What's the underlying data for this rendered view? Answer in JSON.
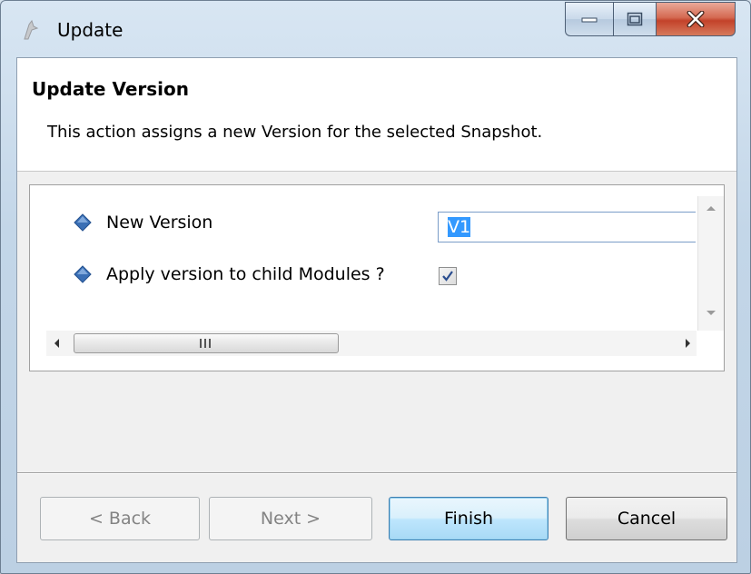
{
  "window": {
    "title": "Update",
    "icons": {
      "app": "app-icon",
      "minimize": "minimize-icon",
      "maximize": "maximize-icon",
      "close": "close-icon"
    }
  },
  "banner": {
    "title": "Update Version",
    "description": "This action assigns a new Version for the selected Snapshot."
  },
  "form": {
    "new_version_label": "New Version",
    "new_version_value": "V1",
    "apply_label": "Apply version to child Modules ?",
    "apply_checked": true,
    "field_icon": "blue-diamond-icon"
  },
  "scrollbars": {
    "horizontal_grip": "III",
    "vertical_position": 0
  },
  "buttons": {
    "back": "< Back",
    "next": "Next >",
    "finish": "Finish",
    "cancel": "Cancel",
    "back_enabled": false,
    "next_enabled": false
  },
  "colors": {
    "titlebar": "#c3d6e8",
    "close_button": "#c3422a",
    "default_button": "#bee6fd",
    "selection": "#3399ff"
  }
}
